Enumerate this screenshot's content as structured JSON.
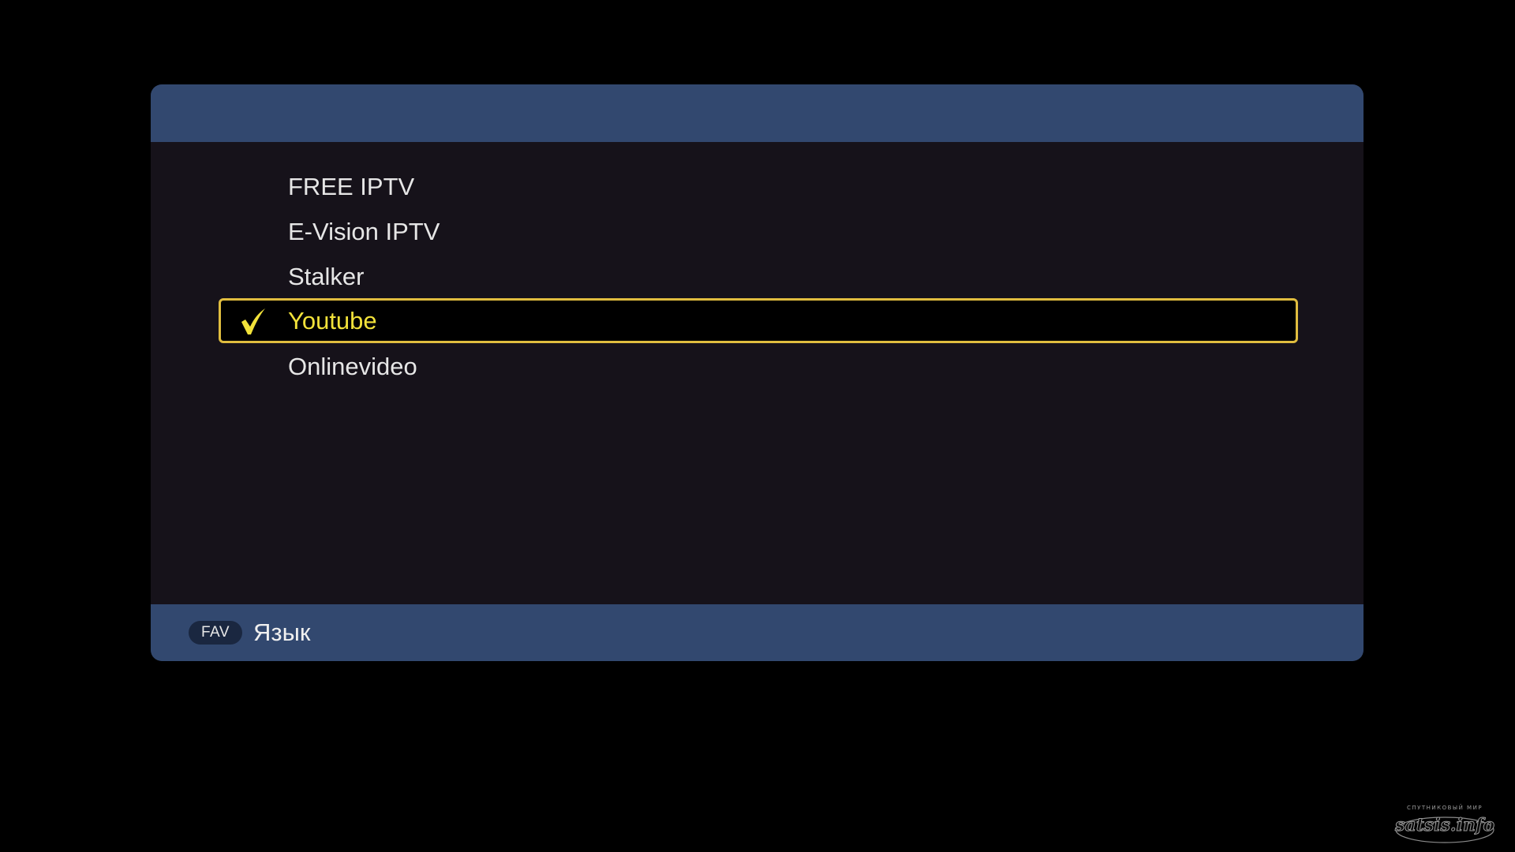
{
  "menu": {
    "items": [
      {
        "label": "FREE IPTV",
        "selected": false
      },
      {
        "label": "E-Vision IPTV",
        "selected": false
      },
      {
        "label": "Stalker",
        "selected": false
      },
      {
        "label": "Youtube",
        "selected": true
      },
      {
        "label": "Onlinevideo",
        "selected": false
      }
    ],
    "selected_icon": "checkmark-icon"
  },
  "footer": {
    "key_label": "FAV",
    "action_label": "Язык"
  },
  "watermark": {
    "top_text": "спутниковый мир",
    "text": "satsis.info"
  },
  "colors": {
    "background": "#000000",
    "panel": "#16121a",
    "header_footer": "#32486f",
    "highlight_border": "#e0bd3f",
    "highlight_text": "#f2e23a",
    "item_text": "#e6e6e6"
  }
}
